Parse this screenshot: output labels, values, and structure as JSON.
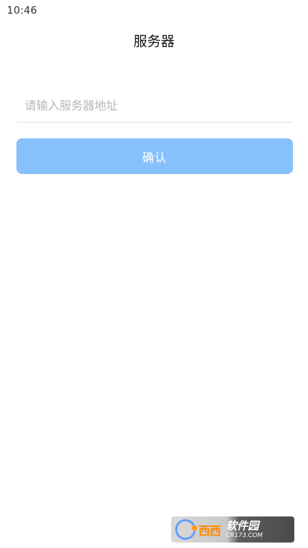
{
  "status_bar": {
    "time": "10:46"
  },
  "header": {
    "title": "服务器"
  },
  "form": {
    "server_address": {
      "placeholder": "请输入服务器地址",
      "value": ""
    },
    "confirm_label": "确认"
  },
  "watermark": {
    "logo_text": "西西",
    "title": "软件园",
    "url": "CR173.COM"
  },
  "colors": {
    "primary_button": "#87c1fb",
    "placeholder": "#b7b7b7",
    "divider": "#e2e2e2"
  }
}
